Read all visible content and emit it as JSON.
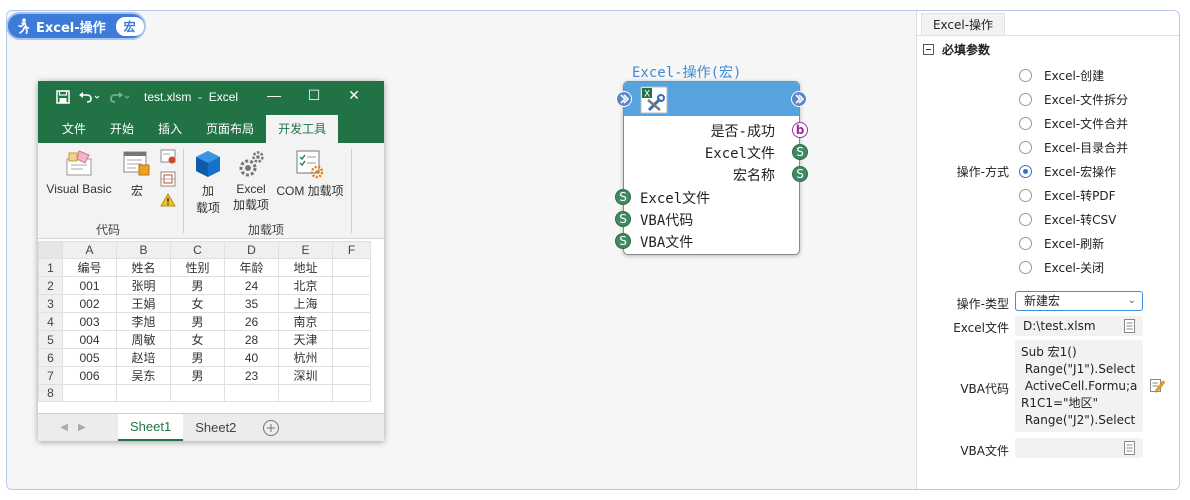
{
  "pill": {
    "title": "Excel-操作",
    "badge": "宏"
  },
  "excel": {
    "filename": "test.xlsm",
    "separator": "-",
    "app": "Excel",
    "tabs": [
      "文件",
      "开始",
      "插入",
      "页面布局",
      "开发工具"
    ],
    "active_tab": 4,
    "ribbon": {
      "visual_basic": "Visual Basic",
      "macro": "宏",
      "group_code": "代码",
      "addin_1": "加",
      "addin_2": "载项",
      "excel_addin_1": "Excel",
      "excel_addin_2": "加载项",
      "com_addin": "COM 加载项",
      "group_addins": "加载项"
    },
    "columns": [
      "A",
      "B",
      "C",
      "D",
      "E",
      "F"
    ],
    "rows": [
      [
        "编号",
        "姓名",
        "性别",
        "年龄",
        "地址",
        ""
      ],
      [
        "001",
        "张明",
        "男",
        "24",
        "北京",
        ""
      ],
      [
        "002",
        "王娟",
        "女",
        "35",
        "上海",
        ""
      ],
      [
        "003",
        "李旭",
        "男",
        "26",
        "南京",
        ""
      ],
      [
        "004",
        "周敏",
        "女",
        "28",
        "天津",
        ""
      ],
      [
        "005",
        "赵培",
        "男",
        "40",
        "杭州",
        ""
      ],
      [
        "006",
        "吴东",
        "男",
        "23",
        "深圳",
        ""
      ],
      [
        "",
        "",
        "",
        "",
        "",
        ""
      ]
    ],
    "row_numbers": [
      "1",
      "2",
      "3",
      "4",
      "5",
      "6",
      "7",
      "8"
    ],
    "sheets": [
      "Sheet1",
      "Sheet2"
    ]
  },
  "node": {
    "title": "Excel-操作(宏)",
    "outputs": [
      {
        "label": "是否-成功",
        "type": "b"
      },
      {
        "label": "Excel文件",
        "type": "S"
      },
      {
        "label": "宏名称",
        "type": "S"
      }
    ],
    "inputs": [
      {
        "label": "Excel文件",
        "type": "S"
      },
      {
        "label": "VBA代码",
        "type": "S"
      },
      {
        "label": "VBA文件",
        "type": "S"
      }
    ]
  },
  "panel": {
    "tab": "Excel-操作",
    "section": "必填参数",
    "op_mode_label": "操作-方式",
    "op_modes": [
      "Excel-创建",
      "Excel-文件拆分",
      "Excel-文件合并",
      "Excel-目录合并",
      "Excel-宏操作",
      "Excel-转PDF",
      "Excel-转CSV",
      "Excel-刷新",
      "Excel-关闭"
    ],
    "op_mode_selected": 4,
    "op_type_label": "操作-类型",
    "op_type_value": "新建宏",
    "excel_file_label": "Excel文件",
    "excel_file_value": "D:\\test.xlsm",
    "vba_code_label": "VBA代码",
    "vba_code_value": "Sub 宏1()\n Range(\"J1\").Select\n ActiveCell.Formu;a\nR1C1=\"地区\"\n Range(\"J2\").Select",
    "vba_file_label": "VBA文件",
    "vba_file_value": ""
  }
}
